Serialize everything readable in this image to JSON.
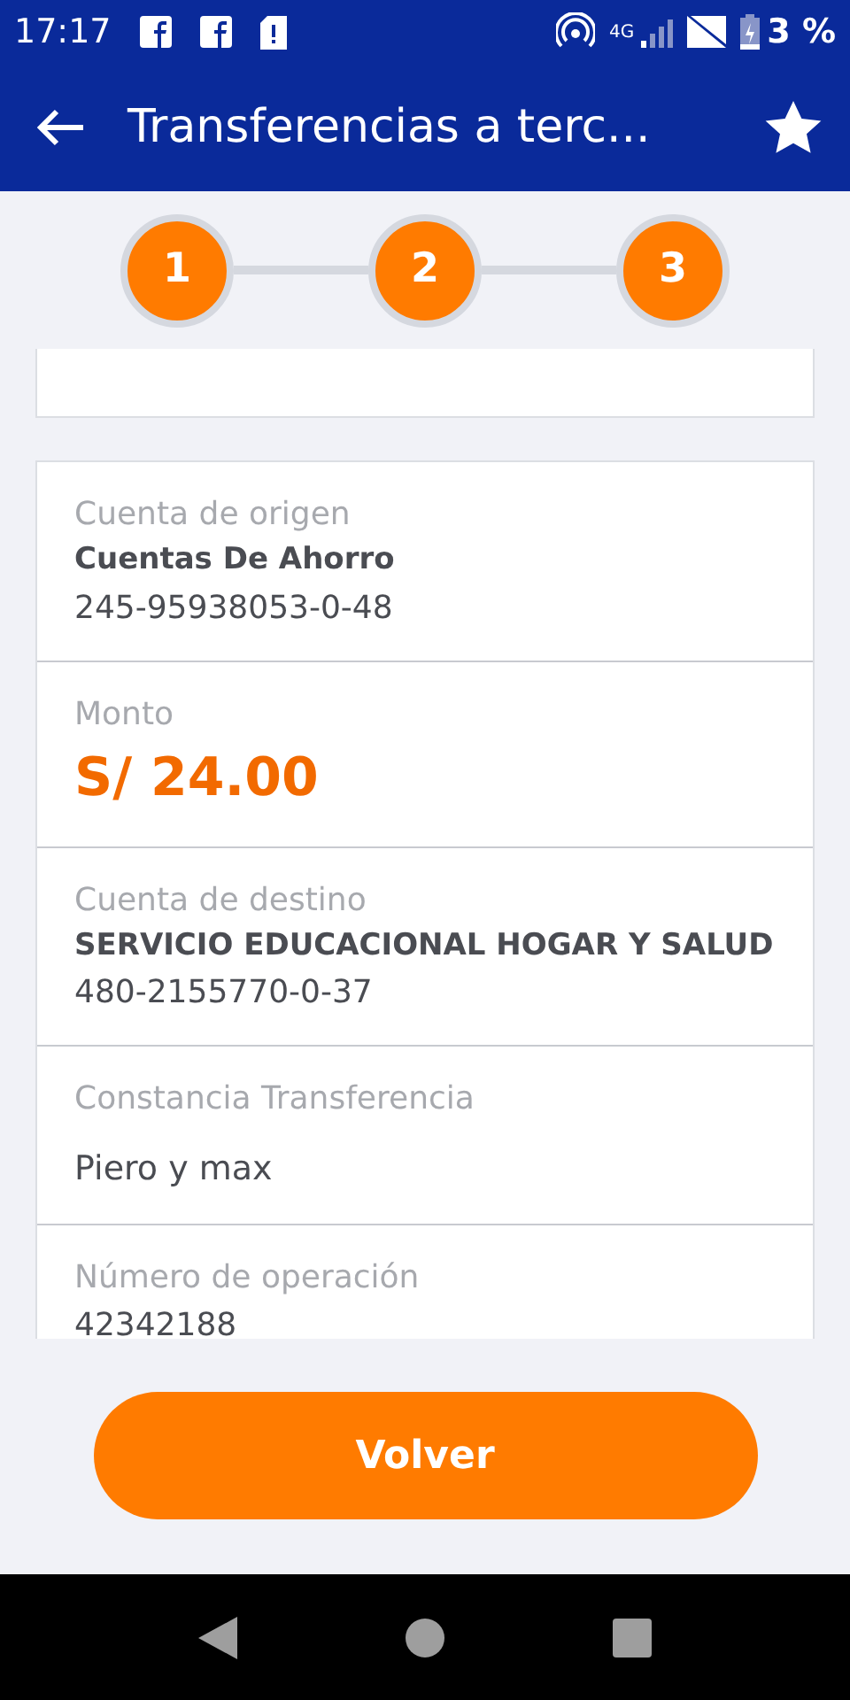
{
  "status_bar": {
    "time": "17:17",
    "network": "4G",
    "battery": "3 %"
  },
  "app_bar": {
    "title": "Transferencias a terc..."
  },
  "steps": [
    {
      "label": "1",
      "done": true
    },
    {
      "label": "2",
      "done": true
    },
    {
      "label": "3",
      "done": true
    }
  ],
  "details": [
    {
      "label": "Cuenta de origen",
      "lines": [
        {
          "kind": "name",
          "text": "Cuentas De Ahorro"
        },
        {
          "kind": "plain",
          "text": "245-95938053-0-48"
        }
      ]
    },
    {
      "label": "Monto",
      "lines": [
        {
          "kind": "amount",
          "text": "S/ 24.00"
        }
      ]
    },
    {
      "label": "Cuenta de destino",
      "lines": [
        {
          "kind": "name",
          "text": "SERVICIO EDUCACIONAL HOGAR Y SALUD"
        },
        {
          "kind": "plain",
          "text": "480-2155770-0-37"
        }
      ]
    },
    {
      "label": "Constancia Transferencia",
      "lines": [
        {
          "kind": "note",
          "text": "Piero y max"
        }
      ]
    },
    {
      "label": "Número de operación",
      "lines": [
        {
          "kind": "plain",
          "text": "42342188"
        }
      ]
    }
  ],
  "button": {
    "label": "Volver"
  }
}
